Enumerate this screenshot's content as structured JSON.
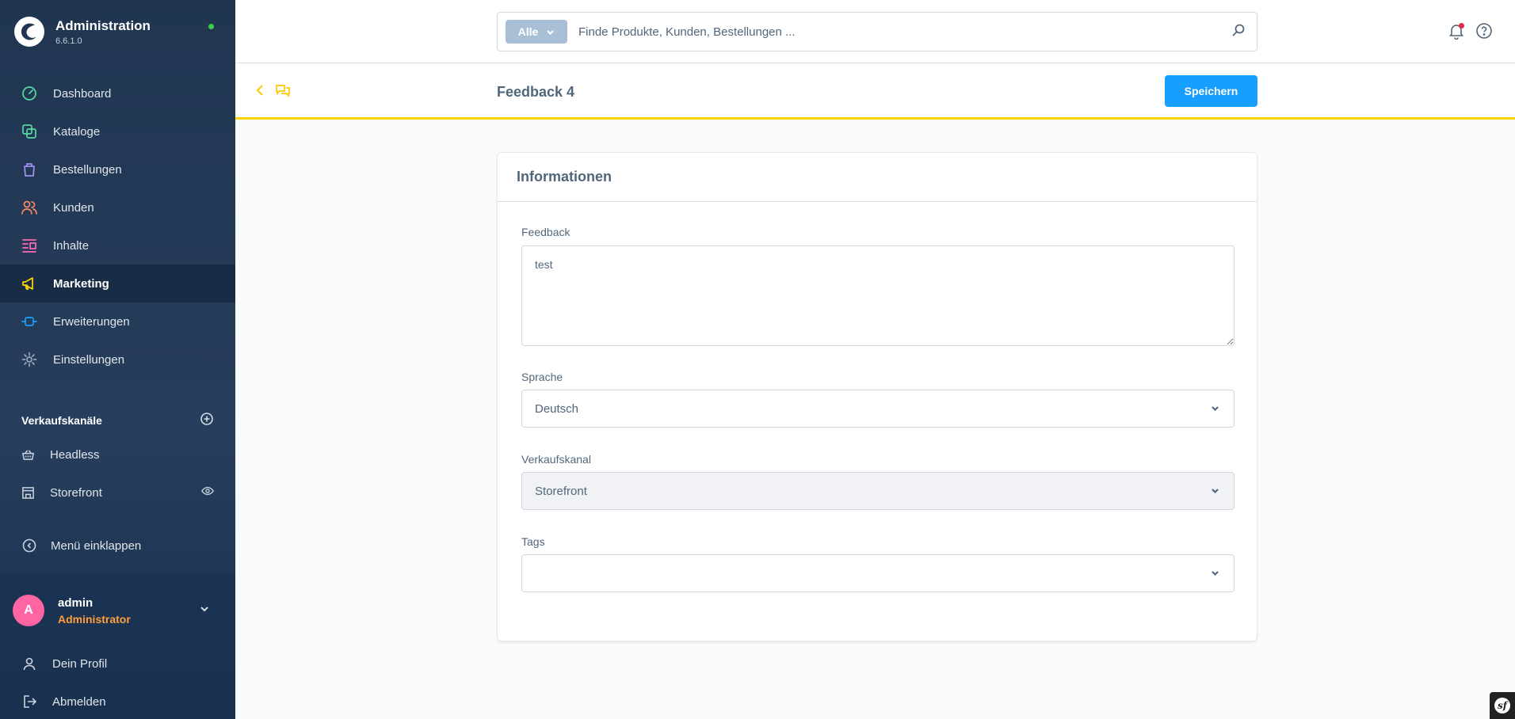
{
  "brand": {
    "title": "Administration",
    "version": "6.6.1.0"
  },
  "nav": {
    "items": [
      {
        "label": "Dashboard",
        "icon": "dashboard-icon",
        "color": "#57d9a3"
      },
      {
        "label": "Kataloge",
        "icon": "catalog-icon",
        "color": "#57d9a3"
      },
      {
        "label": "Bestellungen",
        "icon": "orders-icon",
        "color": "#a092f0"
      },
      {
        "label": "Kunden",
        "icon": "customers-icon",
        "color": "#f88962"
      },
      {
        "label": "Inhalte",
        "icon": "content-icon",
        "color": "#ff68b4"
      },
      {
        "label": "Marketing",
        "icon": "marketing-icon",
        "color": "#ffd700"
      },
      {
        "label": "Erweiterungen",
        "icon": "extensions-icon",
        "color": "#189eff"
      },
      {
        "label": "Einstellungen",
        "icon": "settings-icon",
        "color": "#9aa8b5"
      }
    ]
  },
  "sales_channels": {
    "heading": "Verkaufskanäle",
    "items": [
      {
        "label": "Headless",
        "icon": "basket-icon"
      },
      {
        "label": "Storefront",
        "icon": "storefront-icon"
      }
    ]
  },
  "collapse_label": "Menü einklappen",
  "user": {
    "initial": "A",
    "name": "admin",
    "role": "Administrator",
    "menu": [
      {
        "label": "Dein Profil",
        "icon": "user-icon"
      },
      {
        "label": "Abmelden",
        "icon": "logout-icon"
      }
    ]
  },
  "search": {
    "scope": "Alle",
    "placeholder": "Finde Produkte, Kunden, Bestellungen ..."
  },
  "smartbar": {
    "title": "Feedback 4",
    "save_label": "Speichern"
  },
  "card": {
    "title": "Informationen",
    "feedback_label": "Feedback",
    "feedback_value": "test",
    "language_label": "Sprache",
    "language_value": "Deutsch",
    "channel_label": "Verkaufskanal",
    "channel_value": "Storefront",
    "tags_label": "Tags",
    "tags_value": ""
  },
  "colors": {
    "primary": "#189eff",
    "accent_yellow": "#ffd700",
    "sidebar_bg": "#1f3550",
    "avatar": "#ff65a3",
    "role": "#ff9e3d",
    "online": "#37d046"
  }
}
